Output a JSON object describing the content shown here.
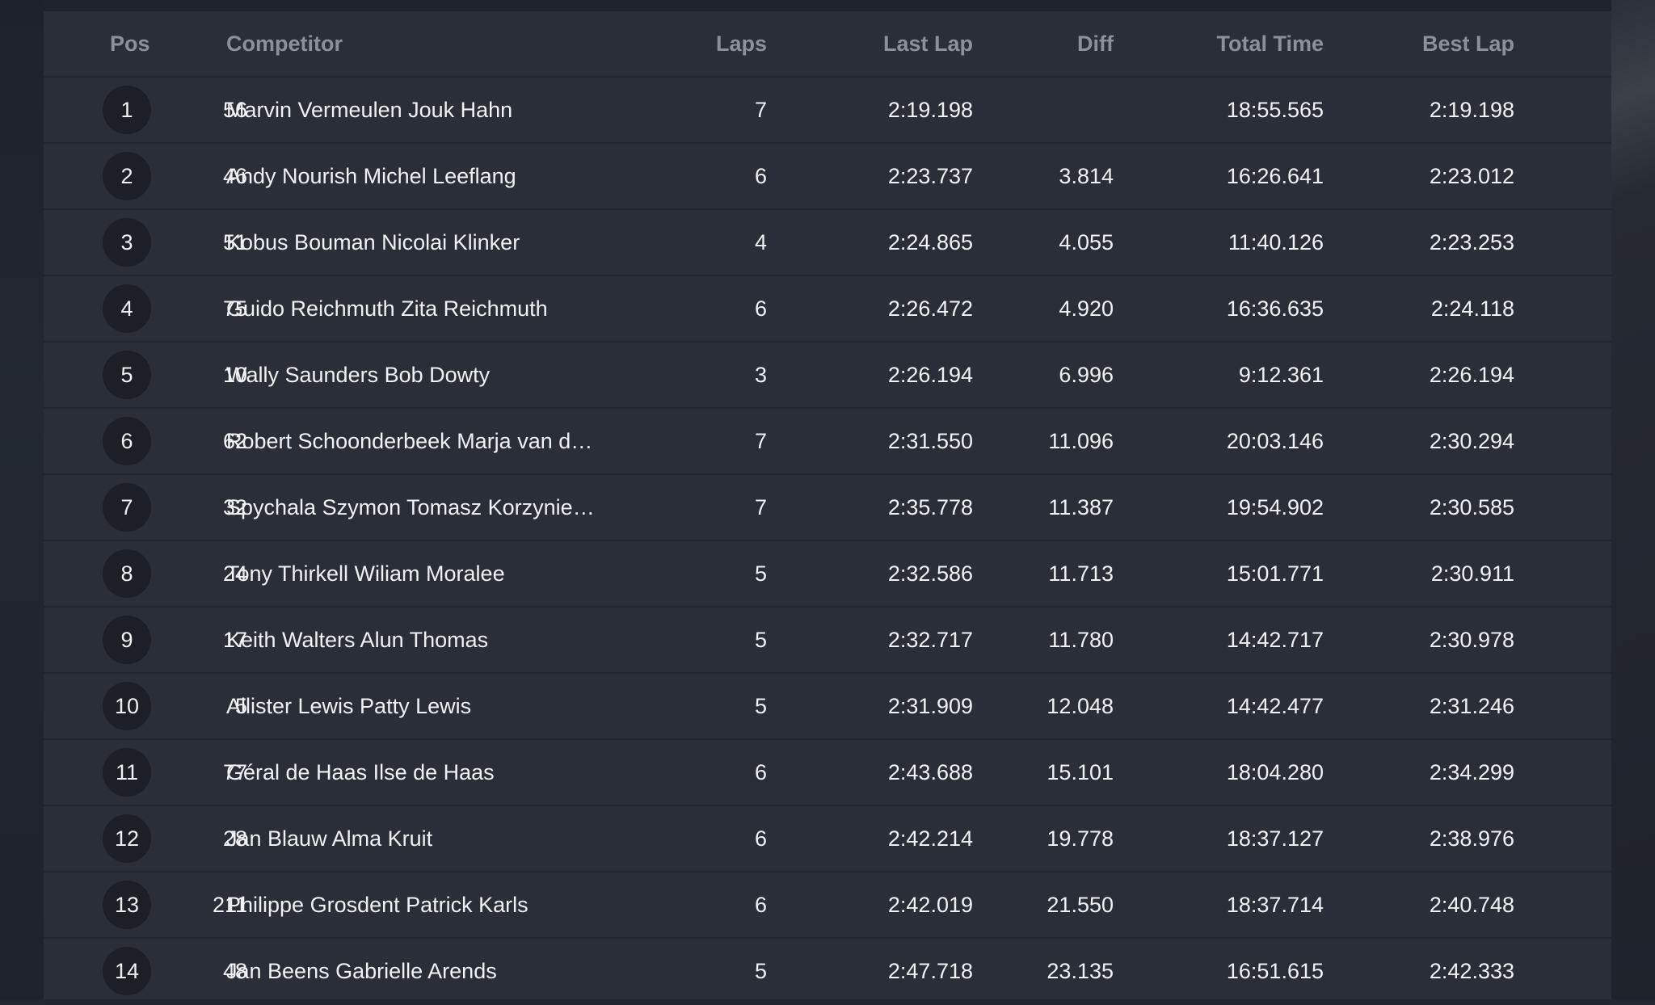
{
  "table": {
    "headers": {
      "pos": "Pos",
      "competitor": "Competitor",
      "laps": "Laps",
      "last_lap": "Last Lap",
      "diff": "Diff",
      "total_time": "Total Time",
      "best_lap": "Best Lap"
    },
    "rows": [
      {
        "pos": "1",
        "num": "56",
        "competitor": "Marvin Vermeulen Jouk Hahn",
        "laps": "7",
        "last_lap": "2:19.198",
        "diff": "",
        "total_time": "18:55.565",
        "best_lap": "2:19.198"
      },
      {
        "pos": "2",
        "num": "46",
        "competitor": "Andy Nourish Michel Leeflang",
        "laps": "6",
        "last_lap": "2:23.737",
        "diff": "3.814",
        "total_time": "16:26.641",
        "best_lap": "2:23.012"
      },
      {
        "pos": "3",
        "num": "51",
        "competitor": "Kobus Bouman Nicolai Klinker",
        "laps": "4",
        "last_lap": "2:24.865",
        "diff": "4.055",
        "total_time": "11:40.126",
        "best_lap": "2:23.253"
      },
      {
        "pos": "4",
        "num": "75",
        "competitor": "Guido Reichmuth Zita Reichmuth",
        "laps": "6",
        "last_lap": "2:26.472",
        "diff": "4.920",
        "total_time": "16:36.635",
        "best_lap": "2:24.118"
      },
      {
        "pos": "5",
        "num": "10",
        "competitor": "Wally Saunders Bob Dowty",
        "laps": "3",
        "last_lap": "2:26.194",
        "diff": "6.996",
        "total_time": "9:12.361",
        "best_lap": "2:26.194"
      },
      {
        "pos": "6",
        "num": "62",
        "competitor": "Robert Schoonderbeek Marja van d…",
        "laps": "7",
        "last_lap": "2:31.550",
        "diff": "11.096",
        "total_time": "20:03.146",
        "best_lap": "2:30.294"
      },
      {
        "pos": "7",
        "num": "32",
        "competitor": "Spychala Szymon Tomasz Korzynie…",
        "laps": "7",
        "last_lap": "2:35.778",
        "diff": "11.387",
        "total_time": "19:54.902",
        "best_lap": "2:30.585"
      },
      {
        "pos": "8",
        "num": "24",
        "competitor": "Tony Thirkell Wiliam Moralee",
        "laps": "5",
        "last_lap": "2:32.586",
        "diff": "11.713",
        "total_time": "15:01.771",
        "best_lap": "2:30.911"
      },
      {
        "pos": "9",
        "num": "17",
        "competitor": "Keith Walters Alun Thomas",
        "laps": "5",
        "last_lap": "2:32.717",
        "diff": "11.780",
        "total_time": "14:42.717",
        "best_lap": "2:30.978"
      },
      {
        "pos": "10",
        "num": "5",
        "competitor": "Allister Lewis Patty Lewis",
        "laps": "5",
        "last_lap": "2:31.909",
        "diff": "12.048",
        "total_time": "14:42.477",
        "best_lap": "2:31.246"
      },
      {
        "pos": "11",
        "num": "77",
        "competitor": "Géral de Haas Ilse de Haas",
        "laps": "6",
        "last_lap": "2:43.688",
        "diff": "15.101",
        "total_time": "18:04.280",
        "best_lap": "2:34.299"
      },
      {
        "pos": "12",
        "num": "28",
        "competitor": "Jan Blauw Alma Kruit",
        "laps": "6",
        "last_lap": "2:42.214",
        "diff": "19.778",
        "total_time": "18:37.127",
        "best_lap": "2:38.976"
      },
      {
        "pos": "13",
        "num": "211",
        "competitor": "Philippe Grosdent Patrick Karls",
        "laps": "6",
        "last_lap": "2:42.019",
        "diff": "21.550",
        "total_time": "18:37.714",
        "best_lap": "2:40.748"
      },
      {
        "pos": "14",
        "num": "48",
        "competitor": "Jan Beens Gabrielle Arends",
        "laps": "5",
        "last_lap": "2:47.718",
        "diff": "23.135",
        "total_time": "16:51.615",
        "best_lap": "2:42.333"
      }
    ]
  }
}
